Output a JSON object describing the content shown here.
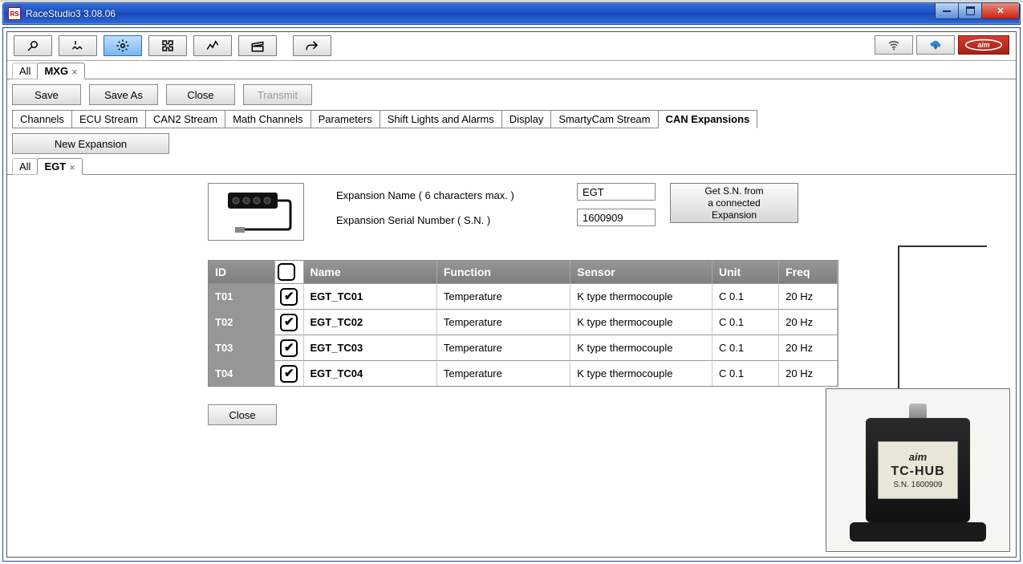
{
  "window": {
    "title": "RaceStudio3  3.08.06"
  },
  "toolbar_icons": [
    "wrench",
    "temperature",
    "gear",
    "puzzle",
    "graph",
    "clapper",
    "share"
  ],
  "right_icons": [
    "wifi",
    "cloud",
    "aim-logo"
  ],
  "device_tabs": {
    "all": "All",
    "active": "MXG"
  },
  "actions": {
    "save": "Save",
    "saveas": "Save As",
    "close": "Close",
    "transmit": "Transmit"
  },
  "config_tabs": [
    "Channels",
    "ECU Stream",
    "CAN2 Stream",
    "Math Channels",
    "Parameters",
    "Shift Lights and Alarms",
    "Display",
    "SmartyCam Stream",
    "CAN Expansions"
  ],
  "config_active": "CAN Expansions",
  "new_expansion": "New Expansion",
  "expansion_tabs": {
    "all": "All",
    "active": "EGT"
  },
  "props": {
    "name_label": "Expansion Name ( 6 characters max. )",
    "name_value": "EGT",
    "sn_label": "Expansion Serial Number ( S.N. )",
    "sn_value": "1600909",
    "getsn_line1": "Get S.N. from",
    "getsn_line2": "a connected",
    "getsn_line3": "Expansion"
  },
  "table": {
    "headers": {
      "id": "ID",
      "name": "Name",
      "function": "Function",
      "sensor": "Sensor",
      "unit": "Unit",
      "freq": "Freq"
    },
    "rows": [
      {
        "id": "T01",
        "name": "EGT_TC01",
        "fn": "Temperature",
        "sensor": "K type thermocouple",
        "unit": "C 0.1",
        "freq": "20 Hz"
      },
      {
        "id": "T02",
        "name": "EGT_TC02",
        "fn": "Temperature",
        "sensor": "K type thermocouple",
        "unit": "C 0.1",
        "freq": "20 Hz"
      },
      {
        "id": "T03",
        "name": "EGT_TC03",
        "fn": "Temperature",
        "sensor": "K type thermocouple",
        "unit": "C 0.1",
        "freq": "20 Hz"
      },
      {
        "id": "T04",
        "name": "EGT_TC04",
        "fn": "Temperature",
        "sensor": "K type thermocouple",
        "unit": "C 0.1",
        "freq": "20 Hz"
      }
    ]
  },
  "close_panel": "Close",
  "tchub": {
    "brand": "aim",
    "name": "TC-HUB",
    "sn": "S.N.  1600909"
  }
}
